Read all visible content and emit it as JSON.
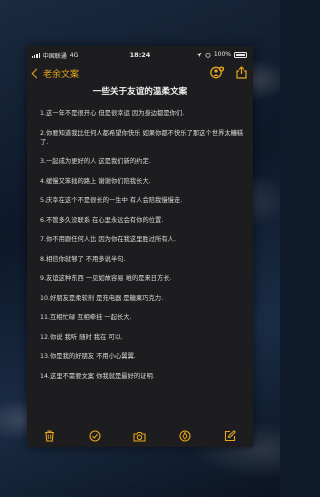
{
  "status": {
    "carrier": "中国联通",
    "network": "4G",
    "time": "18:24",
    "battery": "100%"
  },
  "nav": {
    "back_label": "老余文案"
  },
  "note": {
    "title": "一些关于友谊的温柔文案",
    "lines": [
      "1.这一年不是很开心 但是很幸运 因为身边都是你们.",
      "2.你要知道我比任何人都希望你快乐 如果你都不快乐了那这个世界太糟糕了.",
      "3.一起成为更好的人 这是我们新的约定.",
      "4.缓慢又笨拙的路上 谢谢你们陪我长大.",
      "5.庆幸在这个不是很长的一生中 有人会陪我慢慢走.",
      "6.不管多久没联系 在心里永远会有你的位置.",
      "7.你不用跟任何人比 因为你在我这里胜过所有人.",
      "8.相信你就够了 不用多说半句.",
      "9.友谊这种东西 一见如故容易 难的是来日方长.",
      "10.好朋友是柔软剂 是充电器 是糖果巧克力.",
      "11.互相忙碌 互相牵挂 一起长大.",
      "12.你说 我听 随时 我在 可以.",
      "13.你是我的好朋友 不用小心翼翼.",
      "14.这里不需要文案 你我就是最好的证明."
    ]
  },
  "colors": {
    "accent": "#e7a61c",
    "note_bg": "#1d1d1f",
    "text": "#dcdcdc"
  },
  "icons": [
    "trash-icon",
    "checklist-icon",
    "camera-icon",
    "pen-tip-icon",
    "compose-icon",
    "share-icon",
    "collaborate-icon"
  ]
}
